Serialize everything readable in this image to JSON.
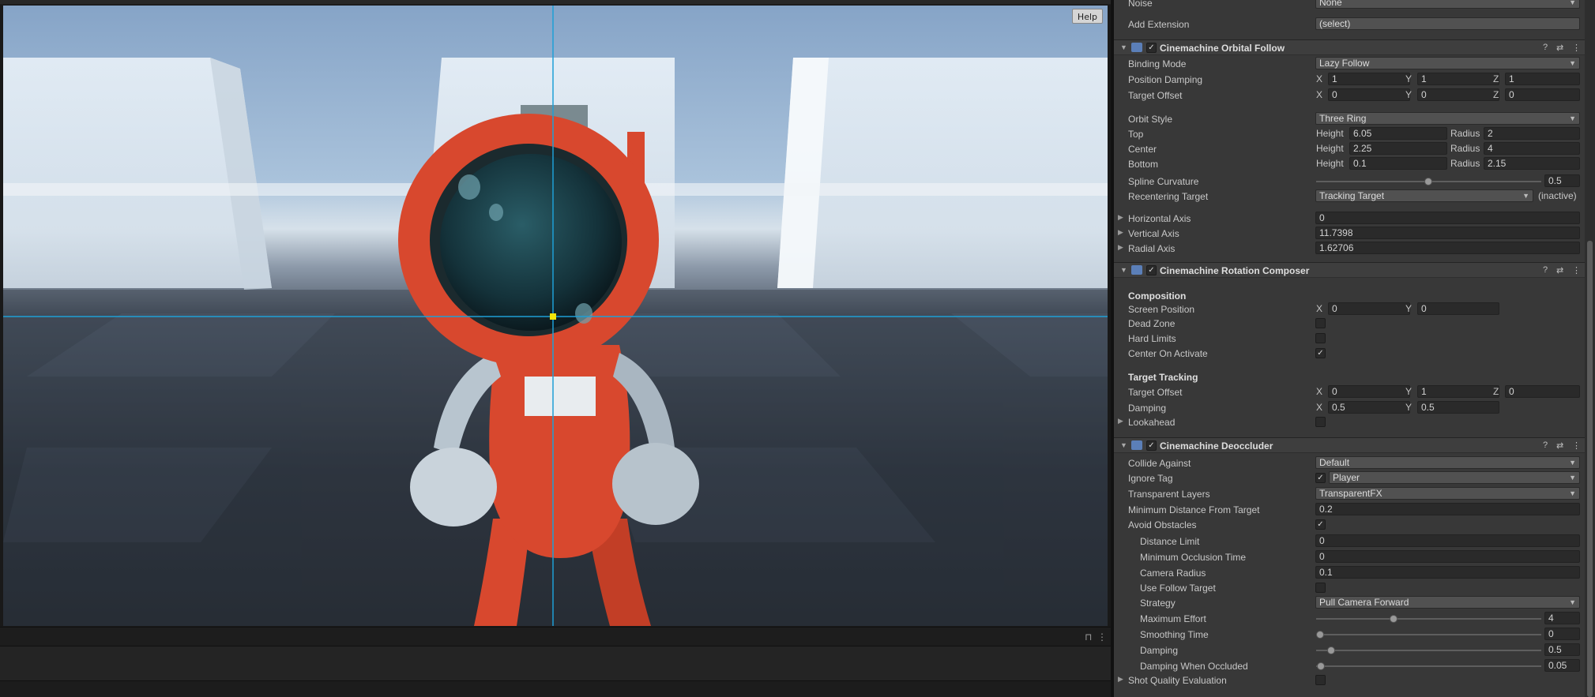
{
  "viewport": {
    "help_label": "Help"
  },
  "extension": {
    "noise_label": "Noise",
    "noise_value": "None",
    "add_label": "Add Extension",
    "add_value": "(select)"
  },
  "orbital": {
    "title": "Cinemachine Orbital Follow",
    "binding_mode_label": "Binding Mode",
    "binding_mode": "Lazy Follow",
    "position_damping_label": "Position Damping",
    "position_damping": [
      "1",
      "1",
      "1"
    ],
    "target_offset_label": "Target Offset",
    "target_offset": [
      "0",
      "0",
      "0"
    ],
    "orbit_style_label": "Orbit Style",
    "orbit_style": "Three Ring",
    "height_label": "Height",
    "radius_label": "Radius",
    "rings": [
      {
        "label": "Top",
        "height": "6.05",
        "radius": "2"
      },
      {
        "label": "Center",
        "height": "2.25",
        "radius": "4"
      },
      {
        "label": "Bottom",
        "height": "0.1",
        "radius": "2.15"
      }
    ],
    "spline_label": "Spline Curvature",
    "spline_value": "0.5",
    "spline_fraction": 0.5,
    "recentering_label": "Recentering Target",
    "recentering_value": "Tracking Target",
    "recentering_status": "(inactive)",
    "axes": [
      {
        "label": "Horizontal Axis",
        "value": "0"
      },
      {
        "label": "Vertical Axis",
        "value": "11.7398"
      },
      {
        "label": "Radial Axis",
        "value": "1.62706"
      }
    ]
  },
  "rotation": {
    "title": "Cinemachine Rotation Composer",
    "composition_label": "Composition",
    "screen_position_label": "Screen Position",
    "screen_position": [
      "0",
      "0"
    ],
    "dead_zone_label": "Dead Zone",
    "dead_zone": false,
    "hard_limits_label": "Hard Limits",
    "hard_limits": false,
    "center_label": "Center On Activate",
    "center": true,
    "tracking_label": "Target Tracking",
    "target_offset_label": "Target Offset",
    "target_offset": [
      "0",
      "1",
      "0"
    ],
    "damping_label": "Damping",
    "damping": [
      "0.5",
      "0.5"
    ],
    "lookahead_label": "Lookahead",
    "lookahead": false
  },
  "deoccluder": {
    "title": "Cinemachine Deoccluder",
    "collide_label": "Collide Against",
    "collide_value": "Default",
    "ignore_label": "Ignore Tag",
    "ignore_checked": true,
    "ignore_value": "Player",
    "transparent_label": "Transparent Layers",
    "transparent_value": "TransparentFX",
    "min_distance_label": "Minimum Distance From Target",
    "min_distance": "0.2",
    "avoid_label": "Avoid Obstacles",
    "avoid": true,
    "distance_limit_label": "Distance Limit",
    "distance_limit": "0",
    "min_occlusion_label": "Minimum Occlusion Time",
    "min_occlusion": "0",
    "camera_radius_label": "Camera Radius",
    "camera_radius": "0.1",
    "use_follow_label": "Use Follow Target",
    "use_follow": false,
    "strategy_label": "Strategy",
    "strategy_value": "Pull Camera Forward",
    "sliders": [
      {
        "label": "Maximum Effort",
        "value": "4",
        "fraction": 0.33
      },
      {
        "label": "Smoothing Time",
        "value": "0",
        "fraction": 0.0
      },
      {
        "label": "Damping",
        "value": "0.5",
        "fraction": 0.05
      },
      {
        "label": "Damping When Occluded",
        "value": "0.05",
        "fraction": 0.005
      }
    ],
    "shot_quality_label": "Shot Quality Evaluation",
    "shot_quality": false
  },
  "colors": {
    "character_red": "#d8482e",
    "crosshair": "#1e9fd6",
    "center_marker": "#f2e40a"
  }
}
